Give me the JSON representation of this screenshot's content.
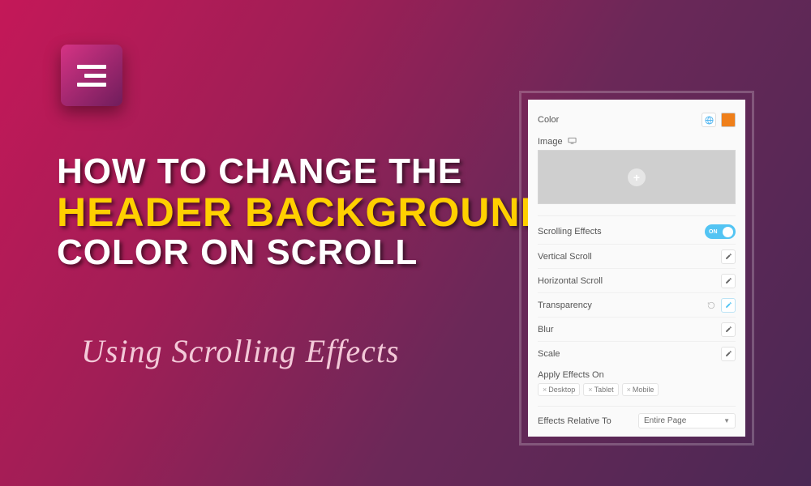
{
  "logo_name": "elementor-logo",
  "headline": {
    "line1": "HOW TO CHANGE THE",
    "line2": "HEADER BACKGROUND",
    "line3": "COLOR ON SCROLL"
  },
  "subtitle": "Using Scrolling Effects",
  "panel": {
    "color_label": "Color",
    "color_swatch": "#ef7f1a",
    "image_label": "Image",
    "scrolling_effects_label": "Scrolling Effects",
    "scrolling_effects_state": "ON",
    "vertical_scroll_label": "Vertical Scroll",
    "horizontal_scroll_label": "Horizontal Scroll",
    "transparency_label": "Transparency",
    "blur_label": "Blur",
    "scale_label": "Scale",
    "apply_effects_label": "Apply Effects On",
    "devices": [
      "Desktop",
      "Tablet",
      "Mobile"
    ],
    "relative_label": "Effects Relative To",
    "relative_value": "Entire Page"
  }
}
